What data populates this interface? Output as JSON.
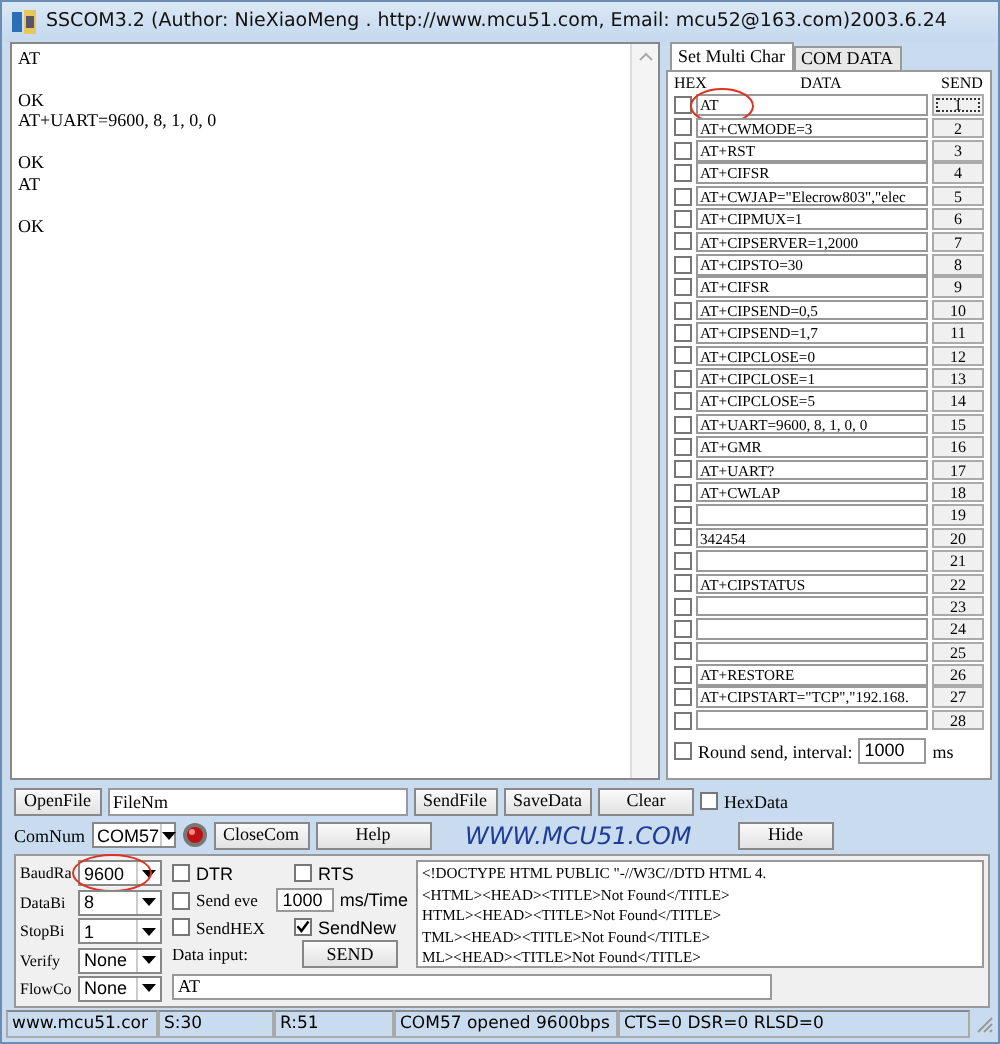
{
  "window": {
    "title": "SSCOM3.2 (Author: NieXiaoMeng . http://www.mcu51.com, Email: mcu52@163.com)2003.6.24"
  },
  "receive_blocks": [
    {
      "lines": [
        "AT"
      ]
    },
    {
      "lines": [
        "OK",
        "AT+UART=9600, 8, 1, 0, 0"
      ]
    },
    {
      "lines": [
        "OK",
        "AT"
      ]
    },
    {
      "lines": [
        "OK"
      ]
    }
  ],
  "tabs": [
    {
      "label": "Set Multi Char",
      "selected": true
    },
    {
      "label": "COM DATA",
      "selected": false
    }
  ],
  "multi_headers": [
    "HEX",
    "DATA",
    "SEND"
  ],
  "multi_rows": [
    {
      "checked": false,
      "data": "AT",
      "send": "1",
      "circled": true
    },
    {
      "checked": false,
      "data": "AT+CWMODE=3",
      "send": "2",
      "circled": false
    },
    {
      "checked": false,
      "data": "AT+RST",
      "send": "3",
      "circled": false
    },
    {
      "checked": false,
      "data": "AT+CIFSR",
      "send": "4",
      "circled": false
    },
    {
      "checked": false,
      "data": "AT+CWJAP=\"Elecrow803\",\"elec",
      "send": "5",
      "circled": false
    },
    {
      "checked": false,
      "data": "AT+CIPMUX=1",
      "send": "6",
      "circled": false
    },
    {
      "checked": false,
      "data": "AT+CIPSERVER=1,2000",
      "send": "7",
      "circled": false
    },
    {
      "checked": false,
      "data": "AT+CIPSTO=30",
      "send": "8",
      "circled": false
    },
    {
      "checked": false,
      "data": "AT+CIFSR",
      "send": "9",
      "circled": false
    },
    {
      "checked": false,
      "data": "AT+CIPSEND=0,5",
      "send": "10",
      "circled": false
    },
    {
      "checked": false,
      "data": "AT+CIPSEND=1,7",
      "send": "11",
      "circled": false
    },
    {
      "checked": false,
      "data": "AT+CIPCLOSE=0",
      "send": "12",
      "circled": false
    },
    {
      "checked": false,
      "data": "AT+CIPCLOSE=1",
      "send": "13",
      "circled": false
    },
    {
      "checked": false,
      "data": "AT+CIPCLOSE=5",
      "send": "14",
      "circled": false
    },
    {
      "checked": false,
      "data": "AT+UART=9600, 8, 1, 0, 0",
      "send": "15",
      "circled": false
    },
    {
      "checked": false,
      "data": "AT+GMR",
      "send": "16",
      "circled": false
    },
    {
      "checked": false,
      "data": "AT+UART?",
      "send": "17",
      "circled": false
    },
    {
      "checked": false,
      "data": "AT+CWLAP",
      "send": "18",
      "circled": false
    },
    {
      "checked": false,
      "send": "19",
      "circled": false
    },
    {
      "checked": false,
      "data": "342454",
      "send": "20",
      "circled": false
    },
    {
      "checked": false,
      "send": "21",
      "circled": false
    },
    {
      "checked": false,
      "data": "AT+CIPSTATUS",
      "send": "22",
      "circled": false
    },
    {
      "checked": false,
      "send": "23",
      "circled": false
    },
    {
      "checked": false,
      "send": "24",
      "circled": false
    },
    {
      "checked": false,
      "send": "25",
      "circled": false
    },
    {
      "checked": false,
      "data": "AT+RESTORE",
      "send": "26",
      "circled": false
    },
    {
      "checked": false,
      "data": "AT+CIPSTART=\"TCP\",\"192.168.",
      "send": "27",
      "circled": false
    },
    {
      "checked": false,
      "send": "28",
      "circled": false
    }
  ],
  "round_send": {
    "label": "Round send, interval:",
    "checked": false,
    "value": "1000",
    "unit": "ms"
  },
  "file_row": {
    "open_button": "OpenFile",
    "file_value": "FileNm",
    "send_file": "SendFile",
    "save_data": "SaveData",
    "clear": "Clear",
    "hex_data": {
      "label": "HexData",
      "checked": false
    }
  },
  "com_row": {
    "label": "ComNum",
    "port": "COM57",
    "close_button": "CloseCom",
    "help_button": "Help",
    "logo": "WWW.MCU51.COM",
    "hide_button": "Hide"
  },
  "settings": [
    {
      "label": "BaudRa",
      "value": "9600",
      "circled": true
    },
    {
      "label": "DataBi",
      "value": "8",
      "circled": false
    },
    {
      "label": "StopBi",
      "value": "1",
      "circled": false
    },
    {
      "label": "Verify",
      "value": "None",
      "circled": false
    },
    {
      "label": "FlowCo",
      "value": "None",
      "circled": false
    }
  ],
  "options": {
    "dtr": {
      "label": "DTR",
      "checked": false
    },
    "rts": {
      "label": "RTS",
      "checked": false
    },
    "send_every": {
      "label": "Send eve",
      "checked": false
    },
    "interval": "1000",
    "interval_unit": "ms/Time",
    "send_hex": {
      "label": "SendHEX",
      "checked": false
    },
    "send_new": {
      "label": "SendNew",
      "checked": true
    },
    "data_input_label": "Data input:",
    "send_button": "SEND"
  },
  "preview_lines": [
    "<!DOCTYPE HTML PUBLIC \"-//W3C//DTD HTML 4.",
    "<HTML><HEAD><TITLE>Not Found</TITLE>",
    "HTML><HEAD><TITLE>Not Found</TITLE>",
    "TML><HEAD><TITLE>Not Found</TITLE>",
    "ML><HEAD><TITLE>Not Found</TITLE>"
  ],
  "data_input": "AT",
  "status_bar": [
    "www.mcu51.cor",
    "S:30",
    "R:51",
    "COM57 opened 9600bps",
    "CTS=0 DSR=0 RLSD=0"
  ]
}
